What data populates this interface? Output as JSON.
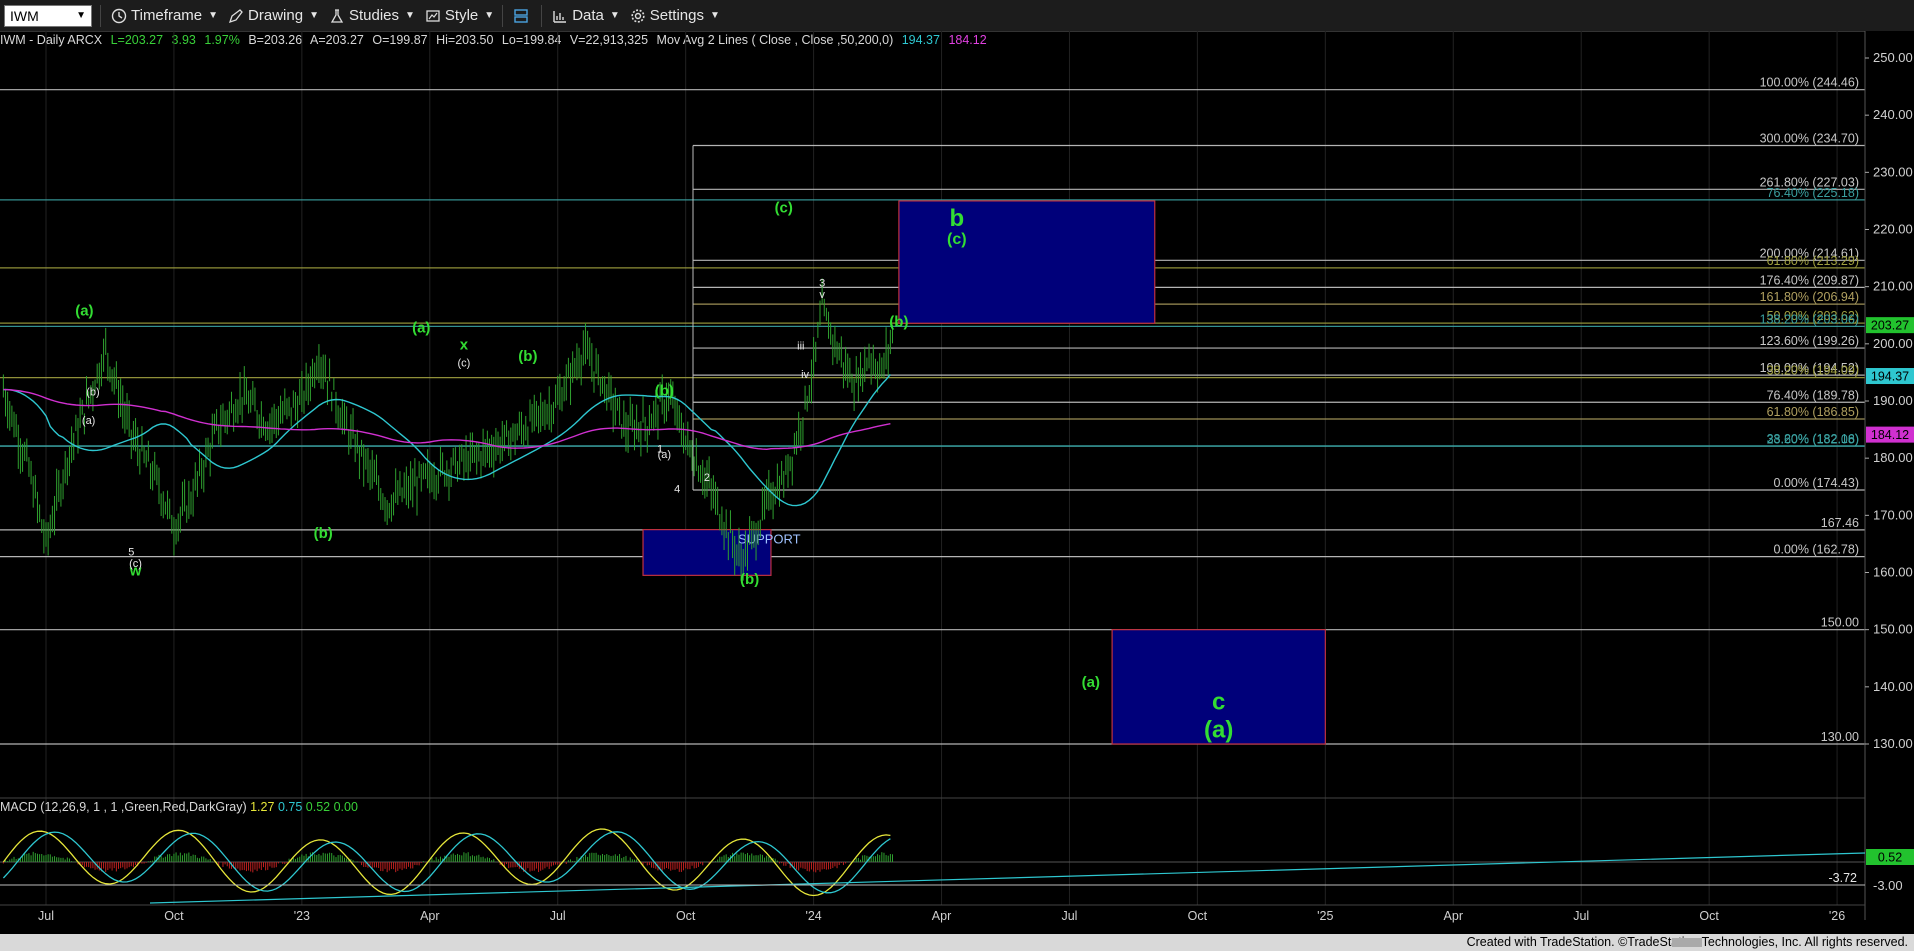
{
  "toolbar": {
    "symbol": "IWM",
    "timeframe_label": "Timeframe",
    "drawing_label": "Drawing",
    "studies_label": "Studies",
    "style_label": "Style",
    "data_label": "Data",
    "settings_label": "Settings"
  },
  "infobar": {
    "title": "IWM - Daily  ARCX",
    "last": "L=203.27",
    "change": "3.93",
    "change_pct": "1.97%",
    "bid": "B=203.26",
    "ask": "A=203.27",
    "open": "O=199.87",
    "high": "Hi=203.50",
    "low": "Lo=199.84",
    "volume": "V=22,913,325",
    "study": "Mov Avg 2 Lines ( Close , Close ,50,200,0)",
    "ma50": "194.37",
    "ma200": "184.12"
  },
  "macd_info": {
    "label": "MACD (12,26,9, 1 , 1 ,Green,Red,DarkGray)",
    "macd": "1.27",
    "signal": "0.75",
    "hist": "0.52",
    "zero": "0.00"
  },
  "footer": "Created with TradeStation. ©TradeStation Technologies, Inc. All rights reserved.",
  "chart_data": {
    "type": "line",
    "title": "IWM - Daily",
    "y_ticks": [
      "250.00",
      "240.00",
      "230.00",
      "220.00",
      "210.00",
      "200.00",
      "190.00",
      "180.00",
      "170.00",
      "160.00",
      "150.00",
      "140.00",
      "130.00"
    ],
    "ylim": [
      126,
      254
    ],
    "x_ticks": [
      "Jul",
      "Oct",
      "'23",
      "Apr",
      "Jul",
      "Oct",
      "'24",
      "Apr",
      "Jul",
      "Oct",
      "'25",
      "Apr",
      "Jul",
      "Oct",
      "'26"
    ],
    "price_badges": [
      {
        "label": "203.27",
        "value": 203.27,
        "color": "#22c22e"
      },
      {
        "label": "194.37",
        "value": 194.37,
        "color": "#2ec7d0"
      },
      {
        "label": "184.12",
        "value": 184.12,
        "color": "#d030d0"
      }
    ],
    "levels": [
      {
        "label": "100.00% (244.46)",
        "value": 244.46,
        "color": "#c8c8c8"
      },
      {
        "label": "300.00% (234.70)",
        "value": 234.7,
        "color": "#c8c8c8"
      },
      {
        "label": "261.80% (227.03)",
        "value": 227.03,
        "color": "#c8c8c8"
      },
      {
        "label": "76.40% (225.18)",
        "value": 225.18,
        "color": "#3aa0a0"
      },
      {
        "label": "200.00% (214.61)",
        "value": 214.61,
        "color": "#c8c8c8"
      },
      {
        "label": "61.80% (213.29)",
        "value": 213.29,
        "color": "#a0a040"
      },
      {
        "label": "176.40% (209.87)",
        "value": 209.87,
        "color": "#c8c8c8"
      },
      {
        "label": "161.80% (206.94)",
        "value": 206.94,
        "color": "#b0a060"
      },
      {
        "label": "50.00% (203.62)",
        "value": 203.62,
        "color": "#a0a040"
      },
      {
        "label": "138.20% (203.06)",
        "value": 203.06,
        "color": "#3aa0a0"
      },
      {
        "label": "123.60% (199.26)",
        "value": 199.26,
        "color": "#c8c8c8"
      },
      {
        "label": "100.00% (194.52)",
        "value": 194.52,
        "color": "#c8c8c8"
      },
      {
        "label": "38.20% (194.09)",
        "value": 194.09,
        "color": "#a0a040"
      },
      {
        "label": "76.40% (189.78)",
        "value": 189.78,
        "color": "#c8c8c8"
      },
      {
        "label": "61.80% (186.85)",
        "value": 186.85,
        "color": "#b0a060"
      },
      {
        "label": "38.20% (182.16)",
        "value": 182.16,
        "color": "#3aa0a0"
      },
      {
        "label": "23.60% (182.08)",
        "value": 182.08,
        "color": "#3aa0a0"
      },
      {
        "label": "0.00% (174.43)",
        "value": 174.43,
        "color": "#c8c8c8"
      },
      {
        "label": "167.46",
        "value": 167.46,
        "color": "#c8c8c8"
      },
      {
        "label": "0.00% (162.78)",
        "value": 162.78,
        "color": "#c8c8c8"
      },
      {
        "label": "150.00",
        "value": 150.0,
        "color": "#c8c8c8"
      },
      {
        "label": "130.00",
        "value": 130.0,
        "color": "#c8c8c8"
      }
    ],
    "target_boxes": [
      {
        "from_date": "2024-03",
        "to_date": "2024-09",
        "low": 203.6,
        "high": 225.0,
        "label_top": "b",
        "label_bottom": "(c)"
      },
      {
        "from_date": "2023-09",
        "to_date": "2023-12",
        "low": 159.5,
        "high": 167.5,
        "label": "SUPPORT"
      },
      {
        "from_date": "2024-08",
        "to_date": "2025-01",
        "low": 130.0,
        "high": 150.0,
        "label_top": "c",
        "label_bottom": "(a)"
      }
    ],
    "wave_labels": [
      {
        "text": "(a)",
        "color": "green"
      },
      {
        "text": "a",
        "color": "green"
      },
      {
        "text": "w",
        "color": "green"
      },
      {
        "text": "x",
        "color": "green"
      },
      {
        "text": "(b)",
        "color": "green"
      },
      {
        "text": "(b)",
        "color": "green"
      },
      {
        "text": "(b)",
        "color": "green"
      },
      {
        "text": "(a)",
        "color": "green"
      },
      {
        "text": "(b)",
        "color": "green"
      },
      {
        "text": "(c)",
        "color": "green"
      },
      {
        "text": "(a)",
        "color": "green"
      },
      {
        "text": "(b)",
        "color": "green"
      },
      {
        "text": "(c)",
        "color": "white"
      },
      {
        "text": "(b)",
        "color": "white"
      },
      {
        "text": "(a)",
        "color": "white"
      },
      {
        "text": "(c)",
        "color": "white"
      },
      {
        "text": "(c)",
        "color": "white"
      },
      {
        "text": "(a)",
        "color": "white"
      },
      {
        "text": "1",
        "color": "white"
      },
      {
        "text": "2",
        "color": "white"
      },
      {
        "text": "3",
        "color": "white"
      },
      {
        "text": "4",
        "color": "white"
      },
      {
        "text": "5",
        "color": "white"
      },
      {
        "text": "iii",
        "color": "white"
      },
      {
        "text": "iv",
        "color": "white"
      },
      {
        "text": "v",
        "color": "white"
      }
    ],
    "macd_ticks": [
      "0.52",
      "-3.72",
      "-3.00"
    ]
  }
}
